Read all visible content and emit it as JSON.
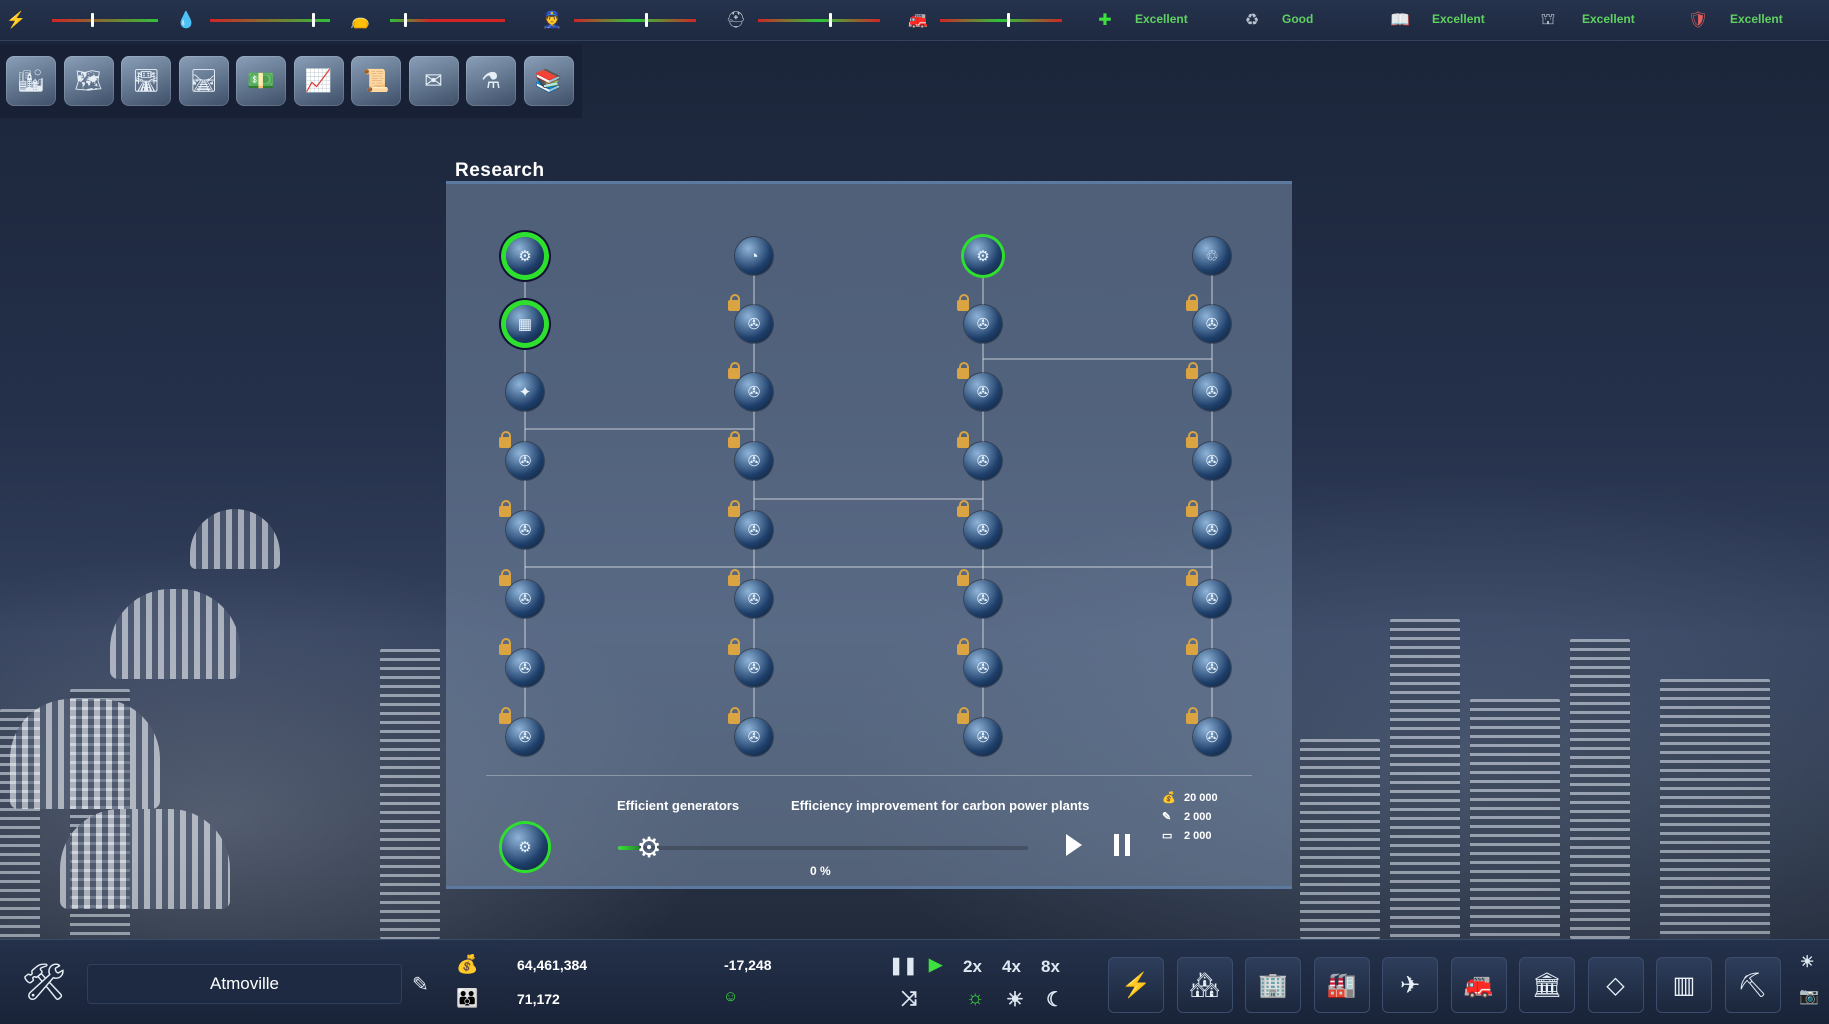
{
  "top_bar": {
    "indicators": [
      {
        "icon": "lightning-icon",
        "glyph": "⚡",
        "color": "#f1c232",
        "level": 0.37
      },
      {
        "icon": "water-drop-icon",
        "glyph": "💧",
        "color": "#3a8fe0",
        "level": 0.85
      },
      {
        "icon": "garbage-bag-icon",
        "glyph": "👝",
        "color": "#c0c6d0",
        "level": 0.12
      },
      {
        "icon": "police-icon",
        "glyph": "👮",
        "color": "#f1c232",
        "level": 0.58
      },
      {
        "icon": "health-icon",
        "glyph": "⛑",
        "color": "#c0c6d0",
        "level": 0.58
      },
      {
        "icon": "fire-icon",
        "glyph": "🚒",
        "color": "#c0c6d0",
        "level": 0.55
      }
    ],
    "ratings": [
      {
        "icon": "health-cross-icon",
        "glyph": "✚",
        "label": "Excellent"
      },
      {
        "icon": "environment-icon",
        "glyph": "♻",
        "label": "Good"
      },
      {
        "icon": "education-icon",
        "glyph": "📖",
        "label": "Excellent"
      },
      {
        "icon": "leisure-icon",
        "glyph": "⛫",
        "label": "Excellent"
      },
      {
        "icon": "safety-icon",
        "glyph": "🛡",
        "label": "Excellent"
      }
    ]
  },
  "category_toolbar": [
    {
      "icon": "city-icon",
      "glyph": "🏙"
    },
    {
      "icon": "map-icon",
      "glyph": "🗺"
    },
    {
      "icon": "roads-icon",
      "glyph": "🛣"
    },
    {
      "icon": "rail-icon",
      "glyph": "🛤"
    },
    {
      "icon": "finance-icon",
      "glyph": "💵"
    },
    {
      "icon": "statistics-icon",
      "glyph": "📈"
    },
    {
      "icon": "documents-icon",
      "glyph": "📜"
    },
    {
      "icon": "mail-icon",
      "glyph": "✉"
    },
    {
      "icon": "research-icon",
      "glyph": "⚗"
    },
    {
      "icon": "library-icon",
      "glyph": "📚"
    }
  ],
  "research": {
    "title": "Research",
    "columns": [
      {
        "nodes": [
          {
            "icon": "carbon-plant-icon",
            "glyph": "⚙",
            "state": "done"
          },
          {
            "icon": "solar-panel-icon",
            "glyph": "▦",
            "state": "done"
          },
          {
            "icon": "efficiency-icon",
            "glyph": "✦",
            "state": "available"
          },
          {
            "icon": "locked-tech-icon",
            "glyph": "✇",
            "state": "locked"
          },
          {
            "icon": "locked-tech-icon",
            "glyph": "✇",
            "state": "locked"
          },
          {
            "icon": "locked-tech-icon",
            "glyph": "✇",
            "state": "locked"
          },
          {
            "icon": "locked-tech-icon",
            "glyph": "✇",
            "state": "locked"
          },
          {
            "icon": "locked-tech-icon",
            "glyph": "✇",
            "state": "locked"
          }
        ]
      },
      {
        "nodes": [
          {
            "icon": "turbine-icon",
            "glyph": "◔",
            "state": "available"
          },
          {
            "icon": "locked-tech-icon",
            "glyph": "✇",
            "state": "locked"
          },
          {
            "icon": "locked-tech-icon",
            "glyph": "✇",
            "state": "locked"
          },
          {
            "icon": "locked-tech-icon",
            "glyph": "✇",
            "state": "locked"
          },
          {
            "icon": "locked-tech-icon",
            "glyph": "✇",
            "state": "locked"
          },
          {
            "icon": "locked-tech-icon",
            "glyph": "✇",
            "state": "locked"
          },
          {
            "icon": "locked-tech-icon",
            "glyph": "✇",
            "state": "locked"
          },
          {
            "icon": "locked-tech-icon",
            "glyph": "✇",
            "state": "locked"
          }
        ]
      },
      {
        "nodes": [
          {
            "icon": "generator-icon",
            "glyph": "⚙",
            "state": "active"
          },
          {
            "icon": "locked-tech-icon",
            "glyph": "✇",
            "state": "locked"
          },
          {
            "icon": "locked-tech-icon",
            "glyph": "✇",
            "state": "locked"
          },
          {
            "icon": "locked-tech-icon",
            "glyph": "✇",
            "state": "locked"
          },
          {
            "icon": "locked-tech-icon",
            "glyph": "✇",
            "state": "locked"
          },
          {
            "icon": "locked-tech-icon",
            "glyph": "✇",
            "state": "locked"
          },
          {
            "icon": "locked-tech-icon",
            "glyph": "✇",
            "state": "locked"
          },
          {
            "icon": "locked-tech-icon",
            "glyph": "✇",
            "state": "locked"
          }
        ]
      },
      {
        "nodes": [
          {
            "icon": "recycle-icon",
            "glyph": "♲",
            "state": "available"
          },
          {
            "icon": "locked-tech-icon",
            "glyph": "✇",
            "state": "locked"
          },
          {
            "icon": "locked-tech-icon",
            "glyph": "✇",
            "state": "locked"
          },
          {
            "icon": "locked-tech-icon",
            "glyph": "✇",
            "state": "locked"
          },
          {
            "icon": "locked-tech-icon",
            "glyph": "✇",
            "state": "locked"
          },
          {
            "icon": "locked-tech-icon",
            "glyph": "✇",
            "state": "locked"
          },
          {
            "icon": "locked-tech-icon",
            "glyph": "✇",
            "state": "locked"
          },
          {
            "icon": "locked-tech-icon",
            "glyph": "✇",
            "state": "locked"
          }
        ]
      }
    ],
    "selected": {
      "icon": "generator-icon",
      "glyph": "⚙",
      "name": "Efficient generators",
      "description": "Efficiency improvement for carbon power plants",
      "progress_percent": "0 %",
      "progress_fraction": 0.05,
      "costs": [
        {
          "icon": "money-icon",
          "glyph": "💰",
          "value": "20 000"
        },
        {
          "icon": "research-points-icon",
          "glyph": "✎",
          "value": "2 000"
        },
        {
          "icon": "materials-icon",
          "glyph": "▭",
          "value": "2 000"
        }
      ]
    }
  },
  "bottom_bar": {
    "city_name": "Atmoville",
    "money": "64,461,384",
    "population": "71,172",
    "balance": "-17,248",
    "speed_labels": [
      "2x",
      "4x",
      "8x"
    ],
    "build_menu": [
      {
        "icon": "energy-building-icon",
        "glyph": "⚡"
      },
      {
        "icon": "residential-icon",
        "glyph": "🏘"
      },
      {
        "icon": "commercial-icon",
        "glyph": "🏢"
      },
      {
        "icon": "industrial-icon",
        "glyph": "🏭"
      },
      {
        "icon": "transport-icon",
        "glyph": "✈"
      },
      {
        "icon": "services-icon",
        "glyph": "🚒"
      },
      {
        "icon": "civic-icon",
        "glyph": "🏛"
      },
      {
        "icon": "landmark-icon",
        "glyph": "◇"
      },
      {
        "icon": "zones-icon",
        "glyph": "▥"
      },
      {
        "icon": "bulldozer-icon",
        "glyph": "⛏"
      }
    ]
  }
}
